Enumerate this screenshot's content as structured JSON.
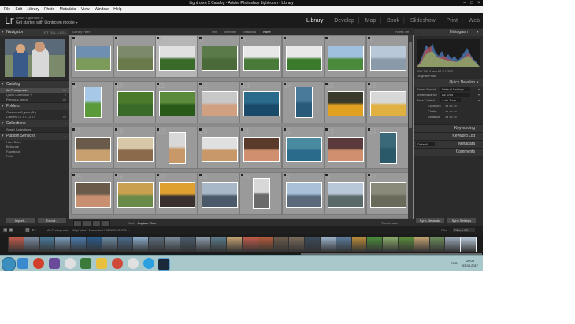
{
  "window": {
    "title": "Lightroom 5 Catalog - Adobe Photoshop Lightroom - Library"
  },
  "menu": [
    "File",
    "Edit",
    "Library",
    "Photo",
    "Metadata",
    "View",
    "Window",
    "Help"
  ],
  "identity": {
    "logo": "Lr",
    "product": "Adobe Lightroom 5",
    "mobile": "Get started with Lightroom mobile ▸"
  },
  "modules": [
    {
      "label": "Library",
      "active": true
    },
    {
      "label": "Develop",
      "active": false
    },
    {
      "label": "Map",
      "active": false
    },
    {
      "label": "Book",
      "active": false
    },
    {
      "label": "Slideshow",
      "active": false
    },
    {
      "label": "Print",
      "active": false
    },
    {
      "label": "Web",
      "active": false
    }
  ],
  "left": {
    "navigator": {
      "title": "Navigator",
      "zoom": "FIT  FILL  1:1  3:1"
    },
    "catalog": {
      "title": "Catalog",
      "items": [
        {
          "label": "All Photographs",
          "count": "49",
          "selected": true
        },
        {
          "label": "Quick Collection +",
          "count": "0",
          "selected": false
        },
        {
          "label": "Previous Import",
          "count": "49",
          "selected": false
        }
      ]
    },
    "folders": {
      "title": "Folders",
      "items": [
        {
          "label": "Локальный диск (D:)",
          "count": "",
          "selected": false
        },
        {
          "label": "Camera 07.07.13 07",
          "count": "49",
          "selected": false
        }
      ]
    },
    "collections": {
      "title": "Collections",
      "items": [
        {
          "label": "Smart Collections",
          "count": "",
          "selected": false
        }
      ]
    },
    "publish": {
      "title": "Publish Services",
      "items": [
        {
          "label": "Hard Drive",
          "count": "",
          "selected": false
        },
        {
          "label": "Behance",
          "count": "",
          "selected": false
        },
        {
          "label": "Facebook",
          "count": "",
          "selected": false
        },
        {
          "label": "Flickr",
          "count": "",
          "selected": false
        }
      ]
    },
    "import_label": "Import...",
    "export_label": "Export..."
  },
  "center": {
    "filter_label": "Library Filter :",
    "filter_options": [
      {
        "label": "Text",
        "on": false
      },
      {
        "label": "Attribute",
        "on": false
      },
      {
        "label": "Metadata",
        "on": false
      },
      {
        "label": "None",
        "on": true
      }
    ],
    "preset": "Filters Off",
    "sort_label": "Sort:",
    "sort_value": "Capture Time",
    "thumbnails_label": "Thumbnails"
  },
  "right": {
    "histogram": {
      "title": "Histogram",
      "info": "ISO 100   4 mm   f/2.8   1/250",
      "original": "Original Photo"
    },
    "quickdevelop": {
      "title": "Quick Develop",
      "rows": [
        {
          "label": "Saved Preset",
          "value": "Default Settings"
        },
        {
          "label": "White Balance",
          "value": "As Shot"
        },
        {
          "label": "Tone Control",
          "value": "Auto Tone"
        },
        {
          "label": "Exposure",
          "value": ""
        },
        {
          "label": "Clarity",
          "value": ""
        },
        {
          "label": "Vibrance",
          "value": ""
        }
      ]
    },
    "keywording": "Keywording",
    "keywordlist": "Keyword List",
    "metadata": {
      "title": "Metadata",
      "preset": "Default"
    },
    "comments": "Comments",
    "sync_label": "Sync Metadata",
    "sync_settings_label": "Sync Settings"
  },
  "filmstrip": {
    "source": "All Photographs",
    "info": "49 photos / 1 selected / 05062013.JPG ▾",
    "filter_label": "Filter :",
    "filter_value": "Filters Off"
  },
  "taskbar": {
    "time": "20:05",
    "date": "03.08.2017",
    "lang": "ENG"
  },
  "thumbs": [
    {
      "n": "1",
      "c1": "#6e8fb0",
      "c2": "#7c9a5a",
      "sel": false
    },
    {
      "n": "2",
      "c1": "#7a8a6a",
      "c2": "#6a7a4a",
      "sel": false
    },
    {
      "n": "3",
      "c1": "#e0e0e0",
      "c2": "#3a6a2a",
      "sel": true
    },
    {
      "n": "4",
      "c1": "#5a7a4a",
      "c2": "#4a6a3a",
      "sel": false
    },
    {
      "n": "5",
      "c1": "#e8e8e8",
      "c2": "#4a7a3a",
      "sel": false
    },
    {
      "n": "6",
      "c1": "#e8e8e8",
      "c2": "#3a7a2a",
      "sel": false
    },
    {
      "n": "7",
      "c1": "#a0c0e0",
      "c2": "#4a8a3a",
      "sel": false
    },
    {
      "n": "8",
      "c1": "#b8c8d8",
      "c2": "#8a9aa8",
      "sel": false
    },
    {
      "n": "9",
      "c1": "#a8c8e8",
      "c2": "#5a9a3a",
      "sel": false
    },
    {
      "n": "10",
      "c1": "#4a7a2a",
      "c2": "#3a6a2a",
      "sel": false
    },
    {
      "n": "11",
      "c1": "#5a8a3a",
      "c2": "#2a5a1a",
      "sel": false
    },
    {
      "n": "12",
      "c1": "#c8c8c8",
      "c2": "#d0a080",
      "sel": false
    },
    {
      "n": "13",
      "c1": "#2a6a8a",
      "c2": "#1a4a6a",
      "sel": false
    },
    {
      "n": "14",
      "c1": "#4a7a9a",
      "c2": "#2a5a7a",
      "sel": false
    },
    {
      "n": "15",
      "c1": "#3a3a2a",
      "c2": "#e0a020",
      "sel": false
    },
    {
      "n": "16",
      "c1": "#d8d8d8",
      "c2": "#e0b040",
      "sel": false
    },
    {
      "n": "17",
      "c1": "#6a5a4a",
      "c2": "#c8a070",
      "sel": false
    },
    {
      "n": "18",
      "c1": "#d8c8a8",
      "c2": "#8a6a4a",
      "sel": false
    },
    {
      "n": "19",
      "c1": "#d8d8d8",
      "c2": "#c89868",
      "sel": false
    },
    {
      "n": "20",
      "c1": "#e0e0e0",
      "c2": "#c89868",
      "sel": false
    },
    {
      "n": "21",
      "c1": "#5a3a2a",
      "c2": "#d09070",
      "sel": false
    },
    {
      "n": "22",
      "c1": "#4a8aa0",
      "c2": "#2a6a8a",
      "sel": false
    },
    {
      "n": "23",
      "c1": "#5a3a3a",
      "c2": "#d09070",
      "sel": false
    },
    {
      "n": "24",
      "c1": "#3a6a7a",
      "c2": "#2a5a6a",
      "sel": false
    },
    {
      "n": "25",
      "c1": "#6a5a4a",
      "c2": "#c89070",
      "sel": false
    },
    {
      "n": "26",
      "c1": "#c8a050",
      "c2": "#6a8a4a",
      "sel": false
    },
    {
      "n": "27",
      "c1": "#e0a030",
      "c2": "#3a3030",
      "sel": false
    },
    {
      "n": "28",
      "c1": "#a8b8c8",
      "c2": "#4a5a6a",
      "sel": false
    },
    {
      "n": "29",
      "c1": "#d8d8d8",
      "c2": "#6a6a6a",
      "sel": false
    },
    {
      "n": "30",
      "c1": "#a8c0d8",
      "c2": "#5a6a7a",
      "sel": false
    },
    {
      "n": "31",
      "c1": "#b8c8d8",
      "c2": "#5a6a6a",
      "sel": false
    },
    {
      "n": "32",
      "c1": "#8a8a7a",
      "c2": "#6a6a5a",
      "sel": false
    },
    {
      "n": "33",
      "c1": "#d8d8d8",
      "c2": "#9a9a9a",
      "sel": false
    },
    {
      "n": "34",
      "c1": "#7a6a5a",
      "c2": "#c09050",
      "sel": false
    },
    {
      "n": "35",
      "c1": "#e0b040",
      "c2": "#4a3a2a",
      "sel": false
    },
    {
      "n": "36",
      "c1": "#6a6a5a",
      "c2": "#a0a090",
      "sel": false
    },
    {
      "n": "37",
      "c1": "#8a8a8a",
      "c2": "#7a7a7a",
      "sel": false
    },
    {
      "n": "38",
      "c1": "#c8d8e8",
      "c2": "#7a8a9a",
      "sel": false
    },
    {
      "n": "39",
      "c1": "#d8d8d8",
      "c2": "#9a9a9a",
      "sel": false
    },
    {
      "n": "40",
      "c1": "#9a9a9a",
      "c2": "#8a8a8a",
      "sel": false
    }
  ],
  "film": [
    "#c05a4a",
    "#7a8aa0",
    "#4a7a9a",
    "#7a9ab8",
    "#4a7aaa",
    "#2a5a8a",
    "#6a8aa0",
    "#4a6a8a",
    "#8aaac8",
    "#5a6a7a",
    "#7a8a9a",
    "#4a5a6a",
    "#8a9aaa",
    "#5a7a8a",
    "#c0a070",
    "#c05a4a",
    "#b05a3a",
    "#6a5a4a",
    "#7a6a5a",
    "#3a4a5a",
    "#9ab0c8",
    "#5a7a9a",
    "#b88a3a",
    "#4a8a3a",
    "#8aaa6a",
    "#5a8a3a",
    "#c0a070",
    "#6a8a5a",
    "#9aa8b8",
    "#b8c8d8"
  ]
}
